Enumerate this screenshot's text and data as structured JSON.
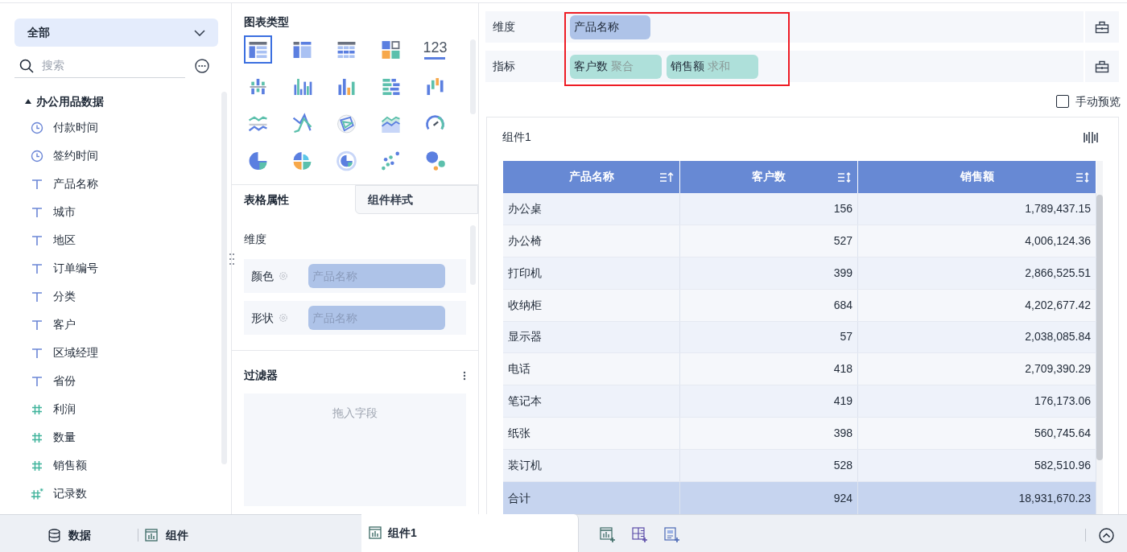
{
  "field_panel": {
    "scope_dropdown": "全部",
    "search": {
      "placeholder": "搜索"
    },
    "dataset": {
      "name": "办公用品数据",
      "expanded": true,
      "children": [
        {
          "name": "付款时间",
          "kind": "time"
        },
        {
          "name": "签约时间",
          "kind": "time"
        },
        {
          "name": "产品名称",
          "kind": "text"
        },
        {
          "name": "城市",
          "kind": "text"
        },
        {
          "name": "地区",
          "kind": "text"
        },
        {
          "name": "订单编号",
          "kind": "text"
        },
        {
          "name": "分类",
          "kind": "text"
        },
        {
          "name": "客户",
          "kind": "text"
        },
        {
          "name": "区域经理",
          "kind": "text"
        },
        {
          "name": "省份",
          "kind": "text"
        },
        {
          "name": "利润",
          "kind": "number"
        },
        {
          "name": "数量",
          "kind": "number"
        },
        {
          "name": "销售额",
          "kind": "number"
        },
        {
          "name": "记录数",
          "kind": "calc"
        }
      ]
    }
  },
  "chart_types": {
    "title": "图表类型",
    "items": [
      {
        "kind": "cross-table",
        "selected": true
      },
      {
        "kind": "group-table",
        "selected": false
      },
      {
        "kind": "detail-table",
        "selected": false
      },
      {
        "kind": "grid",
        "selected": false
      },
      {
        "kind": "kpi",
        "label": "123",
        "selected": false
      },
      {
        "kind": "bar-split",
        "selected": false
      },
      {
        "kind": "bar-group",
        "selected": false
      },
      {
        "kind": "bar-multi",
        "selected": false
      },
      {
        "kind": "bar-horizontal",
        "selected": false
      },
      {
        "kind": "bar-range",
        "selected": false
      },
      {
        "kind": "line-double",
        "selected": false
      },
      {
        "kind": "line-cross",
        "selected": false
      },
      {
        "kind": "radar",
        "selected": false
      },
      {
        "kind": "area",
        "selected": false
      },
      {
        "kind": "gauge",
        "selected": false
      },
      {
        "kind": "pie",
        "selected": false
      },
      {
        "kind": "rose",
        "selected": false
      },
      {
        "kind": "donut",
        "selected": false
      },
      {
        "kind": "scatter",
        "selected": false
      },
      {
        "kind": "bubble",
        "selected": false
      }
    ]
  },
  "property_tabs": [
    {
      "label": "表格属性",
      "selected": true
    },
    {
      "label": "组件样式",
      "selected": false
    }
  ],
  "properties": {
    "section": "维度",
    "rows": [
      {
        "label": "颜色",
        "value": "产品名称"
      },
      {
        "label": "形状",
        "value": "产品名称"
      }
    ]
  },
  "filter": {
    "title": "过滤器",
    "placeholder": "拖入字段"
  },
  "shelves": [
    {
      "label": "维度",
      "pills": [
        {
          "name": "产品名称",
          "kind": "dimension"
        }
      ]
    },
    {
      "label": "指标",
      "pills": [
        {
          "name": "客户数",
          "agg": "聚合",
          "kind": "measure"
        },
        {
          "name": "销售额",
          "agg": "求和",
          "kind": "measure"
        }
      ]
    }
  ],
  "manual_preview": {
    "label": "手动预览",
    "checked": false
  },
  "widget": {
    "title": "组件1",
    "table": {
      "columns": [
        {
          "label": "产品名称",
          "kind": "ascending"
        },
        {
          "label": "客户数",
          "kind": "sortable"
        },
        {
          "label": "销售额",
          "kind": "sortable"
        }
      ],
      "rows": [
        [
          "办公桌",
          "156",
          "1,789,437.15"
        ],
        [
          "办公椅",
          "527",
          "4,006,124.36"
        ],
        [
          "打印机",
          "399",
          "2,866,525.51"
        ],
        [
          "收纳柜",
          "684",
          "4,202,677.42"
        ],
        [
          "显示器",
          "57",
          "2,038,085.84"
        ],
        [
          "电话",
          "418",
          "2,709,390.29"
        ],
        [
          "笔记本",
          "419",
          "176,173.06"
        ],
        [
          "纸张",
          "398",
          "560,745.64"
        ],
        [
          "装订机",
          "528",
          "582,510.96"
        ]
      ],
      "total": [
        "合计",
        "924",
        "18,931,670.23"
      ]
    }
  },
  "bottom_bar": {
    "panel_tabs": [
      {
        "label": "数据",
        "kind": "data"
      },
      {
        "label": "组件",
        "kind": "widget"
      }
    ],
    "sheets": [
      {
        "label": "组件1",
        "selected": true
      }
    ]
  }
}
